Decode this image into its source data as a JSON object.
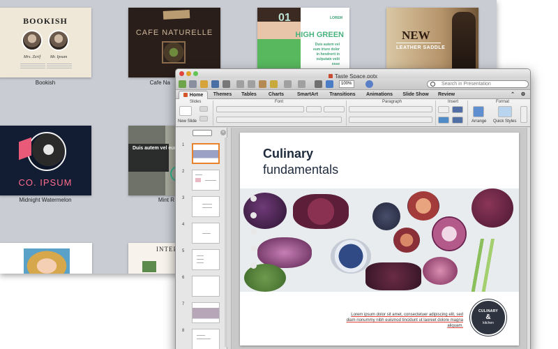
{
  "gallery": {
    "templates": [
      {
        "id": "bookish",
        "label": "Bookish",
        "title": "BOOKISH",
        "names": [
          "Mrs. Zerif",
          "Mr. Ipsum"
        ]
      },
      {
        "id": "cafe",
        "label": "Cafe Na",
        "title": "CAFE NATURELLE"
      },
      {
        "id": "green",
        "label": "",
        "number": "01",
        "tag": "LOREM",
        "title": "HIGH GREEN",
        "body": "Duis autem vel eum iriure dolor in hendrerit in vulputate velit esse"
      },
      {
        "id": "saddle",
        "label": "",
        "title": "NEW",
        "subtitle": "LEATHER SADDLE"
      },
      {
        "id": "midnight",
        "label": "Midnight Watermelon",
        "title": "CO. IPSUM"
      },
      {
        "id": "mint",
        "label": "Mint R",
        "body": "Duis autem vel eum iriure dolor"
      },
      {
        "id": "row3a",
        "label": ""
      },
      {
        "id": "row3b",
        "label": "",
        "title": "INTER"
      }
    ]
  },
  "window": {
    "title": "Taste Space.potx",
    "zoom": "100%",
    "search_placeholder": "Search in Presentation",
    "tabs": [
      "Home",
      "Themes",
      "Tables",
      "Charts",
      "SmartArt",
      "Transitions",
      "Animations",
      "Slide Show",
      "Review"
    ],
    "ribbon_groups": [
      "Slides",
      "Font",
      "Paragraph",
      "Insert",
      "Format"
    ],
    "ribbon_labels": {
      "new_slide": "New Slide",
      "arrange": "Arrange",
      "quick_styles": "Quick Styles"
    }
  },
  "thumbnails": {
    "numbers": [
      "1",
      "2",
      "3",
      "4",
      "5",
      "6",
      "7",
      "8"
    ],
    "selected": "1"
  },
  "slide": {
    "title": "Culinary",
    "subtitle": "fundamentals",
    "body": "Lorem ipsum dolor sit amet, consectetuer adipiscing elit, sed diam nonummy nibh euismod tincidunt ut laoreet dolore magna aliquam.",
    "logo": {
      "top": "CULINARY",
      "mid": "&",
      "bottom": "kitchen"
    }
  },
  "colors": {
    "accent": "#e8822c",
    "brand": "#d45527",
    "slide_dark": "#1e2a3c"
  }
}
